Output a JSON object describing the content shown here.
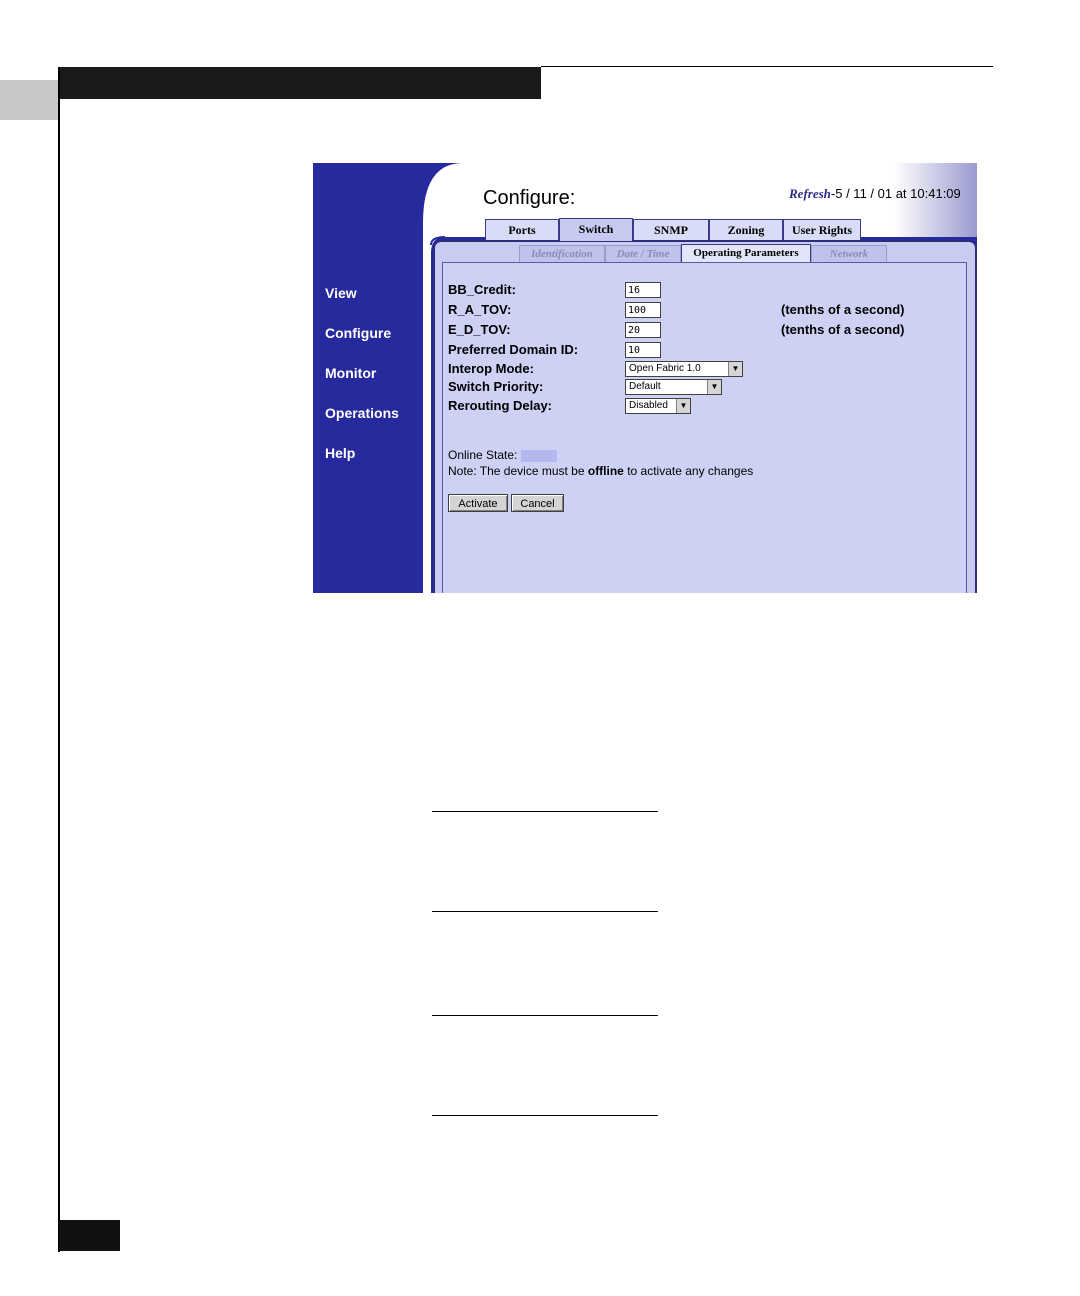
{
  "colors": {
    "nav_bg": "#262a9c",
    "panel_bg": "#c8ccf0",
    "tab_bg": "#d8dcf6"
  },
  "app": {
    "title": "Configure:",
    "refresh_label": "Refresh",
    "refresh_time": "5 / 11 / 01 at 10:41:09"
  },
  "nav": {
    "items": [
      {
        "label": "View"
      },
      {
        "label": "Configure"
      },
      {
        "label": "Monitor"
      },
      {
        "label": "Operations"
      },
      {
        "label": "Help"
      }
    ]
  },
  "tabs": [
    {
      "label": "Ports"
    },
    {
      "label": "Switch"
    },
    {
      "label": "SNMP"
    },
    {
      "label": "Zoning"
    },
    {
      "label": "User Rights"
    }
  ],
  "subtabs": [
    {
      "label": "Identification"
    },
    {
      "label": "Date / Time"
    },
    {
      "label": "Operating Parameters"
    },
    {
      "label": "Network"
    }
  ],
  "form": {
    "bb_credit": {
      "label": "BB_Credit:",
      "value": "16"
    },
    "r_a_tov": {
      "label": "R_A_TOV:",
      "value": "100",
      "unit": "(tenths of a second)"
    },
    "e_d_tov": {
      "label": "E_D_TOV:",
      "value": "20",
      "unit": "(tenths of a second)"
    },
    "domain_id": {
      "label": "Preferred Domain ID:",
      "value": "10"
    },
    "interop_mode": {
      "label": "Interop Mode:",
      "value": "Open Fabric 1.0"
    },
    "switch_priority": {
      "label": "Switch Priority:",
      "value": "Default"
    },
    "rerouting_delay": {
      "label": "Rerouting Delay:",
      "value": "Disabled"
    }
  },
  "status": {
    "online_state_label": "Online State:",
    "note_prefix": "Note: The device must be ",
    "note_bold": "offline",
    "note_suffix": " to activate any changes"
  },
  "buttons": {
    "activate": "Activate",
    "cancel": "Cancel"
  }
}
